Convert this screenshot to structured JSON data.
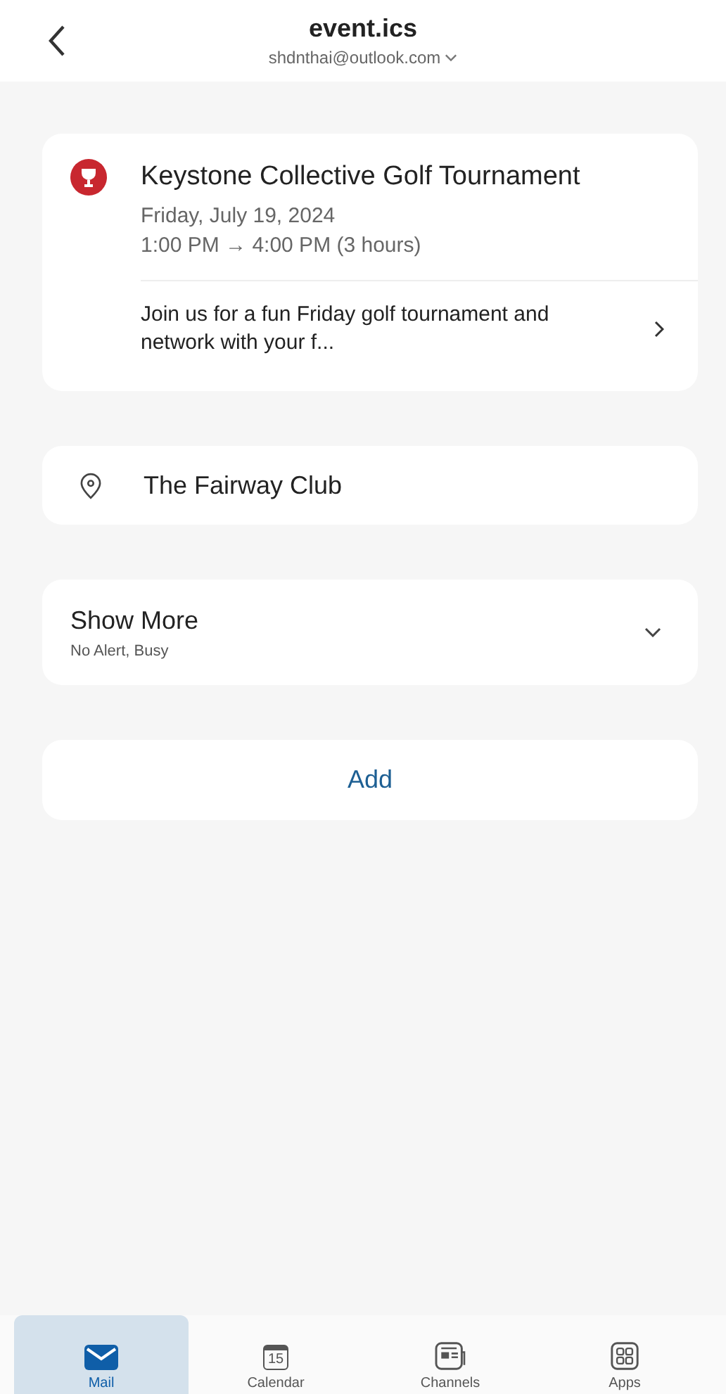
{
  "header": {
    "title": "event.ics",
    "account": "shdnthai@outlook.com"
  },
  "event": {
    "title": "Keystone Collective Golf Tournament",
    "date": "Friday, July 19, 2024",
    "time": "1:00 PM → 4:00 PM (3 hours)",
    "description": "Join us for a fun Friday golf tournament and network with your f..."
  },
  "location": "The Fairway Club",
  "show_more": {
    "label": "Show More",
    "summary": "No Alert, Busy"
  },
  "add_button": "Add",
  "tabs": [
    {
      "kind": "mail",
      "label": "Mail",
      "selected": true
    },
    {
      "kind": "calendar",
      "label": "Calendar",
      "icon_text": "15",
      "selected": false
    },
    {
      "kind": "channels",
      "label": "Channels",
      "selected": false
    },
    {
      "kind": "apps",
      "label": "Apps",
      "selected": false
    }
  ]
}
